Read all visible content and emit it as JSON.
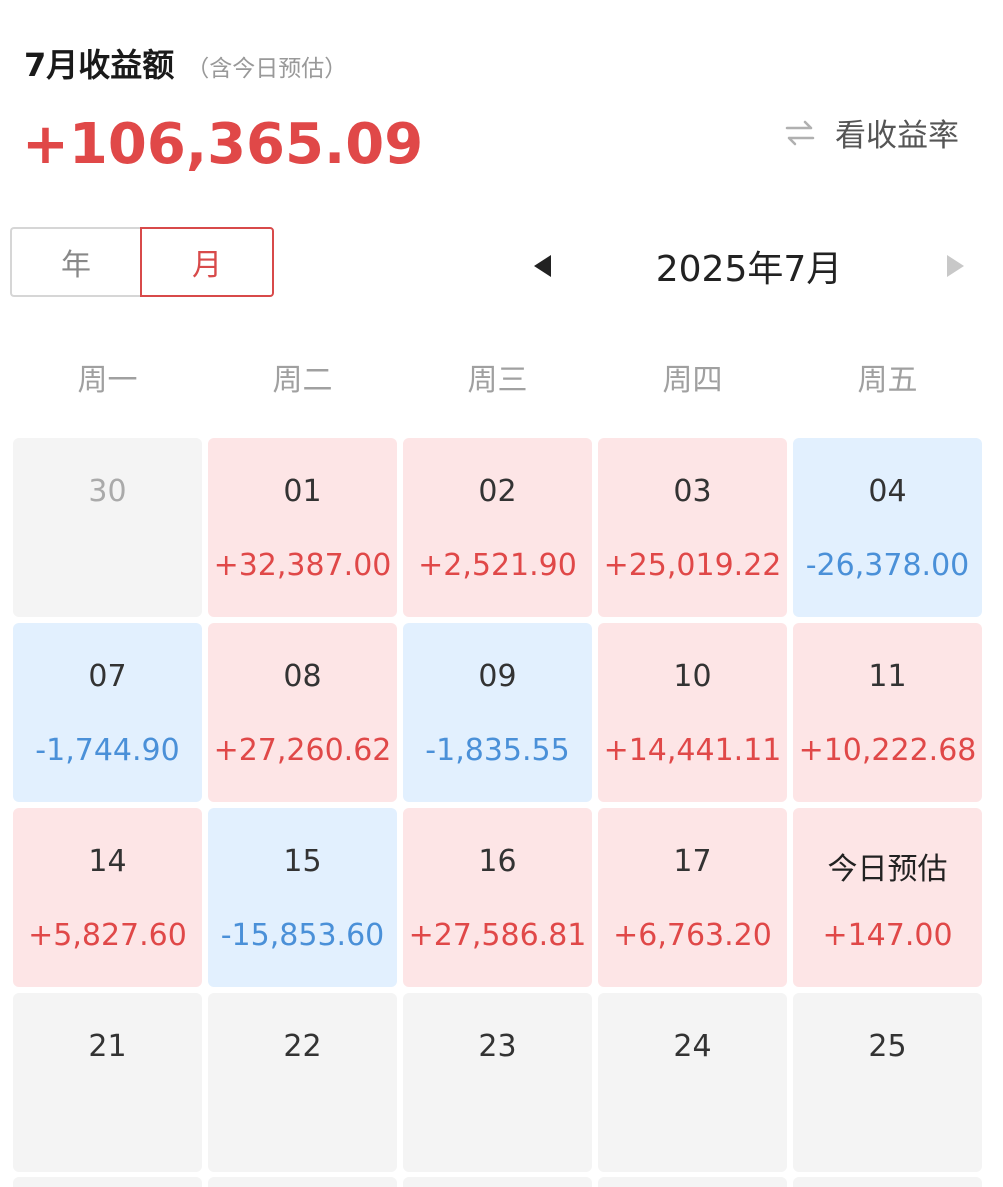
{
  "header": {
    "title": "7月收益额",
    "subtitle": "（含今日预估）",
    "total": "+106,365.09",
    "toggle_label": "看收益率"
  },
  "segmented": {
    "year_label": "年",
    "month_label": "月",
    "active": "month"
  },
  "month_nav": {
    "label": "2025年7月"
  },
  "weekdays": [
    "周一",
    "周二",
    "周三",
    "周四",
    "周五"
  ],
  "calendar": {
    "cells": [
      {
        "day": "30",
        "amount": "",
        "type": "empty",
        "muted": true
      },
      {
        "day": "01",
        "amount": "+32,387.00",
        "type": "pos"
      },
      {
        "day": "02",
        "amount": "+2,521.90",
        "type": "pos"
      },
      {
        "day": "03",
        "amount": "+25,019.22",
        "type": "pos"
      },
      {
        "day": "04",
        "amount": "-26,378.00",
        "type": "neg"
      },
      {
        "day": "07",
        "amount": "-1,744.90",
        "type": "neg"
      },
      {
        "day": "08",
        "amount": "+27,260.62",
        "type": "pos"
      },
      {
        "day": "09",
        "amount": "-1,835.55",
        "type": "neg"
      },
      {
        "day": "10",
        "amount": "+14,441.11",
        "type": "pos"
      },
      {
        "day": "11",
        "amount": "+10,222.68",
        "type": "pos"
      },
      {
        "day": "14",
        "amount": "+5,827.60",
        "type": "pos"
      },
      {
        "day": "15",
        "amount": "-15,853.60",
        "type": "neg"
      },
      {
        "day": "16",
        "amount": "+27,586.81",
        "type": "pos"
      },
      {
        "day": "17",
        "amount": "+6,763.20",
        "type": "pos"
      },
      {
        "day": "今日预估",
        "amount": "+147.00",
        "type": "pos",
        "today": true
      },
      {
        "day": "21",
        "amount": "",
        "type": "empty"
      },
      {
        "day": "22",
        "amount": "",
        "type": "empty"
      },
      {
        "day": "23",
        "amount": "",
        "type": "empty"
      },
      {
        "day": "24",
        "amount": "",
        "type": "empty"
      },
      {
        "day": "25",
        "amount": "",
        "type": "empty"
      }
    ]
  },
  "colors": {
    "positive_text": "#e04848",
    "negative_text": "#4a90d8",
    "positive_bg": "#fde5e6",
    "negative_bg": "#e2f0fe",
    "empty_bg": "#f4f4f4",
    "accent": "#d84a4a"
  },
  "icons": {
    "toggle": "swap-arrows-icon",
    "prev": "triangle-left-icon",
    "next": "triangle-right-icon"
  }
}
